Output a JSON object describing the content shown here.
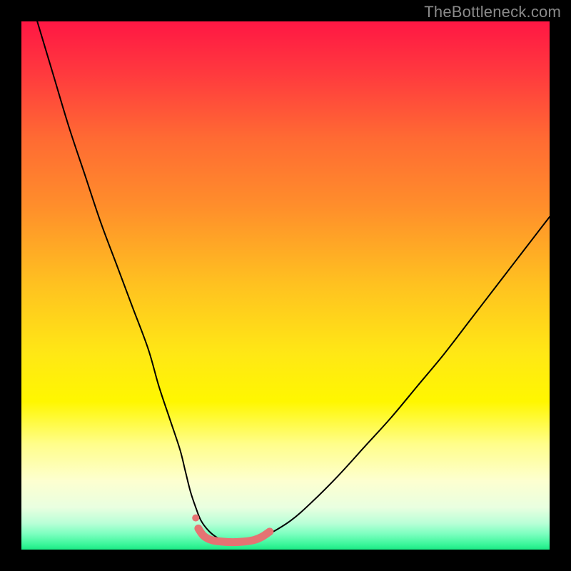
{
  "watermark": "TheBottleneck.com",
  "gradient_stops": [
    {
      "offset": 0.0,
      "color": "#ff1744"
    },
    {
      "offset": 0.1,
      "color": "#ff3a3e"
    },
    {
      "offset": 0.22,
      "color": "#ff6a33"
    },
    {
      "offset": 0.35,
      "color": "#ff8e2b"
    },
    {
      "offset": 0.5,
      "color": "#ffc220"
    },
    {
      "offset": 0.63,
      "color": "#ffe815"
    },
    {
      "offset": 0.72,
      "color": "#fff700"
    },
    {
      "offset": 0.8,
      "color": "#fffe8a"
    },
    {
      "offset": 0.87,
      "color": "#fdffd0"
    },
    {
      "offset": 0.92,
      "color": "#e9ffe0"
    },
    {
      "offset": 0.95,
      "color": "#b9ffd7"
    },
    {
      "offset": 0.97,
      "color": "#7dffc0"
    },
    {
      "offset": 0.99,
      "color": "#3bf69a"
    },
    {
      "offset": 1.0,
      "color": "#1be985"
    }
  ],
  "chart_data": {
    "type": "line",
    "title": "",
    "xlabel": "",
    "ylabel": "",
    "xlim": [
      0,
      100
    ],
    "ylim": [
      0,
      100
    ],
    "series": [
      {
        "name": "bottleneck-curve",
        "color": "#000000",
        "x": [
          3,
          6,
          9,
          12,
          15,
          18,
          21,
          24,
          26,
          28,
          30,
          31,
          32,
          33,
          34,
          35.5,
          37,
          38.5,
          40,
          41.5,
          43,
          45,
          47,
          51,
          55,
          60,
          65,
          70,
          75,
          80,
          85,
          90,
          95,
          100
        ],
        "values": [
          100,
          90,
          80,
          71,
          62,
          54,
          46,
          38,
          31,
          25,
          19,
          15,
          11,
          8,
          5.5,
          3.5,
          2.3,
          1.6,
          1.3,
          1.3,
          1.5,
          2.0,
          3.0,
          5.5,
          9,
          14,
          19.5,
          25,
          31,
          37,
          43.5,
          50,
          56.5,
          63
        ]
      },
      {
        "name": "bottom-highlight",
        "color": "#e57373",
        "x": [
          33.5,
          34.5,
          36,
          38,
          40,
          42,
          44,
          45.5,
          47
        ],
        "values": [
          4.0,
          2.6,
          1.8,
          1.5,
          1.4,
          1.5,
          1.8,
          2.4,
          3.4
        ]
      }
    ],
    "markers": [
      {
        "name": "left-dot",
        "x": 33.0,
        "y": 6.0,
        "color": "#e57373",
        "r": 5
      },
      {
        "name": "right-dot",
        "x": 47.0,
        "y": 3.4,
        "color": "#e57373",
        "r": 5
      }
    ]
  }
}
